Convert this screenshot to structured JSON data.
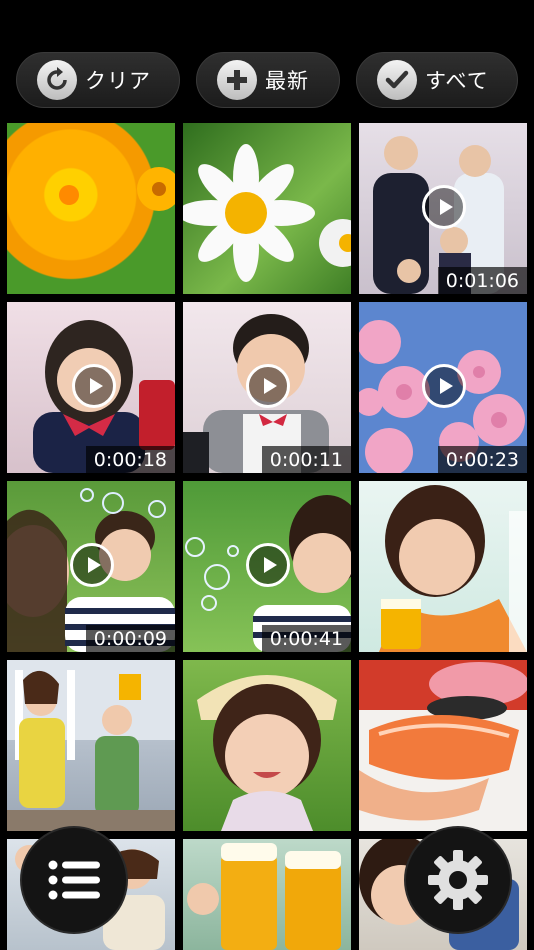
{
  "toolbar": {
    "clear_label": "クリア",
    "latest_label": "最新",
    "all_label": "すべて"
  },
  "grid": {
    "tiles": [
      {
        "kind": "photo",
        "subject": "orange flower"
      },
      {
        "kind": "photo",
        "subject": "white daisy"
      },
      {
        "kind": "video",
        "subject": "family",
        "duration": "0:01:06"
      },
      {
        "kind": "video",
        "subject": "girl with bow",
        "duration": "0:00:18"
      },
      {
        "kind": "video",
        "subject": "boy in uniform",
        "duration": "0:00:11"
      },
      {
        "kind": "video",
        "subject": "cherry blossoms",
        "duration": "0:00:23"
      },
      {
        "kind": "video",
        "subject": "girl blowing bubbles with mother",
        "duration": "0:00:09"
      },
      {
        "kind": "video",
        "subject": "girl blowing bubbles",
        "duration": "0:00:41"
      },
      {
        "kind": "photo",
        "subject": "woman with beer"
      },
      {
        "kind": "photo",
        "subject": "two women with beer"
      },
      {
        "kind": "photo",
        "subject": "smiling child"
      },
      {
        "kind": "photo",
        "subject": "sushi"
      },
      {
        "kind": "photo",
        "subject": "friends toasting"
      },
      {
        "kind": "photo",
        "subject": "beer glasses toast"
      },
      {
        "kind": "photo",
        "subject": "woman smiling"
      }
    ]
  },
  "fabs": {
    "menu_icon": "list-icon",
    "settings_icon": "gear-icon"
  }
}
